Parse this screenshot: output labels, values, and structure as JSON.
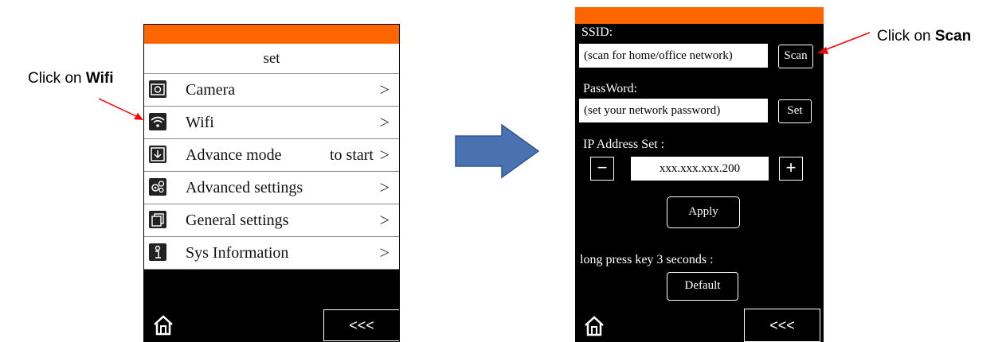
{
  "left_callout": {
    "prefix": "Click on ",
    "bold": "Wifi"
  },
  "right_callout": {
    "prefix": "Click on ",
    "bold": "Scan"
  },
  "screen1": {
    "title": "set",
    "items": [
      {
        "icon": "camera-icon",
        "label": "Camera",
        "right": ""
      },
      {
        "icon": "wifi-icon",
        "label": "Wifi",
        "right": ""
      },
      {
        "icon": "download-icon",
        "label": "Advance mode",
        "right": "to start"
      },
      {
        "icon": "settings-gears-icon",
        "label": "Advanced settings",
        "right": ""
      },
      {
        "icon": "copy-icon",
        "label": "General settings",
        "right": ""
      },
      {
        "icon": "info-icon",
        "label": "Sys Information",
        "right": ""
      }
    ],
    "chevron": ">",
    "back_label": "<<<"
  },
  "screen2": {
    "ssid_label": "SSID:",
    "ssid_value": "(scan for home/office network)",
    "scan_label": "Scan",
    "password_label": "PassWord:",
    "password_value": "(set your network password)",
    "set_label": "Set",
    "ip_label": "IP Address Set :",
    "ip_value": "xxx.xxx.xxx.200",
    "minus_label": "−",
    "plus_label": "+",
    "apply_label": "Apply",
    "longpress_label": "long press key 3 seconds :",
    "default_label": "Default",
    "back_label": "<<<"
  },
  "colors": {
    "accent": "#ff6600",
    "arrow_blue": "#4a72b0",
    "callout_red": "#ff0000"
  }
}
